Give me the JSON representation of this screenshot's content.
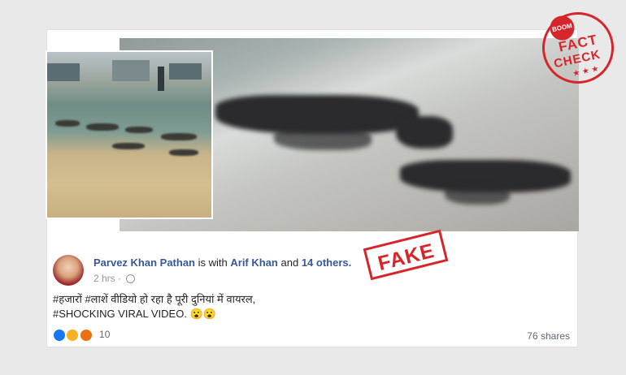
{
  "stamp": {
    "badge": "BOOM",
    "line1": "FACT",
    "line2": "CHECK",
    "stars": "★ ★ ★"
  },
  "post": {
    "author": "Parvez Khan Pathan",
    "with_text": "is with",
    "tagged": "Arif Khan",
    "and_text": "and",
    "others": "14 others.",
    "time": "2 hrs",
    "line1": "#हजारों #लाशें वीडियो हो रहा है पूरी दुनियां में वायरल,",
    "line2": "#SHOCKING VIRAL VIDEO. 😮😮",
    "reaction_count": "10",
    "shares": "76 shares"
  },
  "fake_label": "FAKE",
  "colors": {
    "link": "#365899",
    "stamp_red": "#d7262b"
  }
}
